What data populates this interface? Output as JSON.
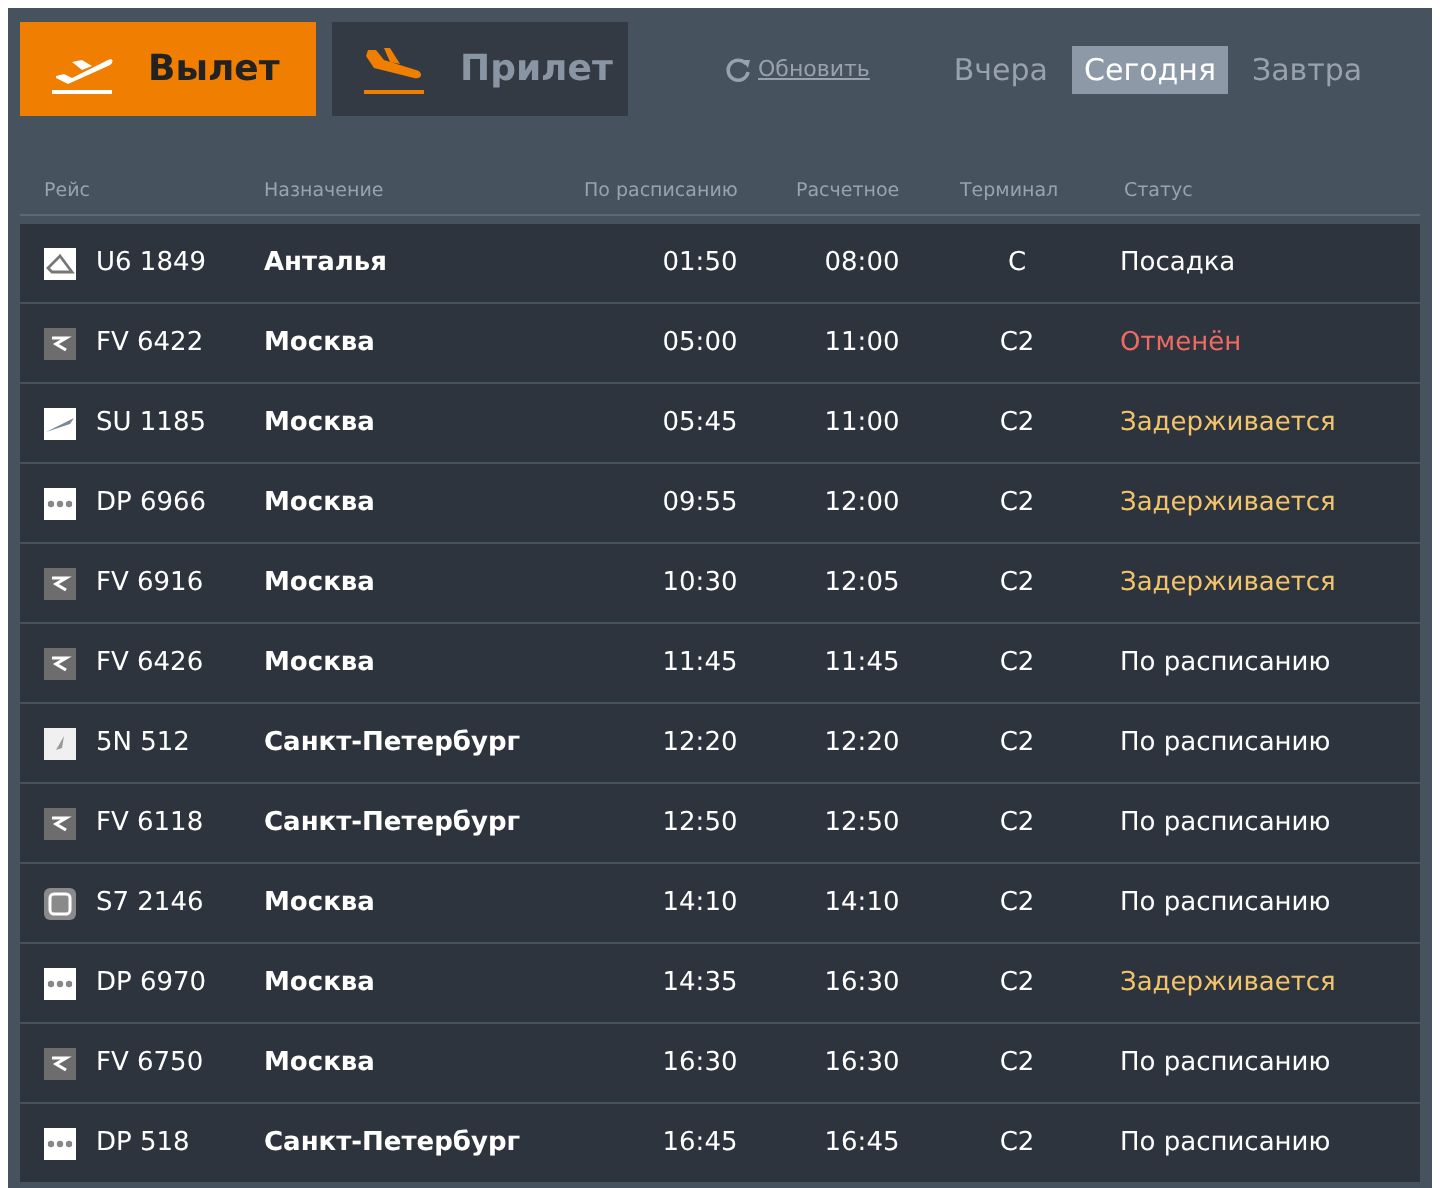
{
  "direction_tabs": [
    {
      "label": "Вылет",
      "kind": "departure",
      "selected": true
    },
    {
      "label": "Прилет",
      "kind": "arrival",
      "selected": false
    }
  ],
  "refresh": {
    "label": "Обновить"
  },
  "day_tabs": [
    {
      "label": "Вчера",
      "selected": false
    },
    {
      "label": "Сегодня",
      "selected": true
    },
    {
      "label": "Завтра",
      "selected": false
    }
  ],
  "table": {
    "columns": [
      "Рейс",
      "Назначение",
      "По расписанию",
      "Расчетное",
      "Терминал",
      "Статус"
    ],
    "rows": [
      {
        "logo": {
          "kind": "ut"
        },
        "flight": "U6 1849",
        "destination": "Анталья",
        "scheduled": "01:50",
        "estimated": "08:00",
        "terminal": "C",
        "status": {
          "text": "Посадка",
          "kind": "normal"
        }
      },
      {
        "logo": {
          "kind": "fv"
        },
        "flight": "FV 6422",
        "destination": "Москва",
        "scheduled": "05:00",
        "estimated": "11:00",
        "terminal": "C2",
        "status": {
          "text": "Отменён",
          "kind": "cancelled"
        }
      },
      {
        "logo": {
          "kind": "su"
        },
        "flight": "SU 1185",
        "destination": "Москва",
        "scheduled": "05:45",
        "estimated": "11:00",
        "terminal": "C2",
        "status": {
          "text": "Задерживается",
          "kind": "delayed"
        }
      },
      {
        "logo": {
          "kind": "dp"
        },
        "flight": "DP 6966",
        "destination": "Москва",
        "scheduled": "09:55",
        "estimated": "12:00",
        "terminal": "C2",
        "status": {
          "text": "Задерживается",
          "kind": "delayed"
        }
      },
      {
        "logo": {
          "kind": "fv"
        },
        "flight": "FV 6916",
        "destination": "Москва",
        "scheduled": "10:30",
        "estimated": "12:05",
        "terminal": "C2",
        "status": {
          "text": "Задерживается",
          "kind": "delayed"
        }
      },
      {
        "logo": {
          "kind": "fv"
        },
        "flight": "FV 6426",
        "destination": "Москва",
        "scheduled": "11:45",
        "estimated": "11:45",
        "terminal": "C2",
        "status": {
          "text": "По расписанию",
          "kind": "normal"
        }
      },
      {
        "logo": {
          "kind": "quill"
        },
        "flight": "5N 512",
        "destination": "Санкт-Петербург",
        "scheduled": "12:20",
        "estimated": "12:20",
        "terminal": "C2",
        "status": {
          "text": "По расписанию",
          "kind": "normal"
        }
      },
      {
        "logo": {
          "kind": "fv"
        },
        "flight": "FV 6118",
        "destination": "Санкт-Петербург",
        "scheduled": "12:50",
        "estimated": "12:50",
        "terminal": "C2",
        "status": {
          "text": "По расписанию",
          "kind": "normal"
        }
      },
      {
        "logo": {
          "kind": "s7"
        },
        "flight": "S7 2146",
        "destination": "Москва",
        "scheduled": "14:10",
        "estimated": "14:10",
        "terminal": "C2",
        "status": {
          "text": "По расписанию",
          "kind": "normal"
        }
      },
      {
        "logo": {
          "kind": "dp"
        },
        "flight": "DP 6970",
        "destination": "Москва",
        "scheduled": "14:35",
        "estimated": "16:30",
        "terminal": "C2",
        "status": {
          "text": "Задерживается",
          "kind": "delayed"
        }
      },
      {
        "logo": {
          "kind": "fv"
        },
        "flight": "FV 6750",
        "destination": "Москва",
        "scheduled": "16:30",
        "estimated": "16:30",
        "terminal": "C2",
        "status": {
          "text": "По расписанию",
          "kind": "normal"
        }
      },
      {
        "logo": {
          "kind": "dp"
        },
        "flight": "DP 518",
        "destination": "Санкт-Петербург",
        "scheduled": "16:45",
        "estimated": "16:45",
        "terminal": "C2",
        "status": {
          "text": "По расписанию",
          "kind": "normal"
        }
      }
    ]
  }
}
